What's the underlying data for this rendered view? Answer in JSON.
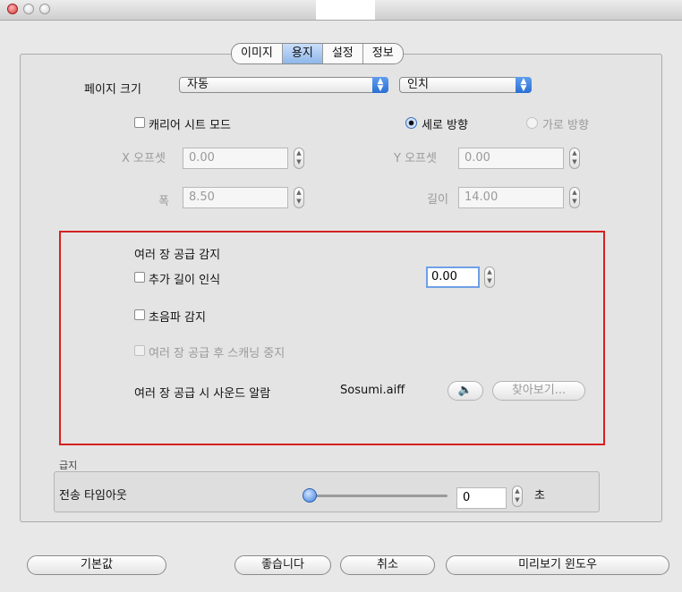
{
  "tabs": [
    "이미지",
    "용지",
    "설정",
    "정보"
  ],
  "selected_tab": "용지",
  "page_size": {
    "label": "페이지 크기",
    "value": "자동",
    "unit": "인치"
  },
  "carrier_sheet": {
    "label": "캐리어 시트 모드",
    "checked": false
  },
  "orientation": {
    "portrait": "세로 방향",
    "landscape": "가로 방향",
    "selected": "portrait"
  },
  "offsets": {
    "x_label": "X 오프셋",
    "x_value": "0.00",
    "y_label": "Y 오프셋",
    "y_value": "0.00",
    "width_label": "폭",
    "width_value": "8.50",
    "length_label": "길이",
    "length_value": "14.00"
  },
  "multifeed": {
    "title": "여러 장 공급 감지",
    "extra_length_label": "추가 길이 인식",
    "extra_length_value": "0.00",
    "ultrasonic_label": "초음파 감지",
    "stop_label": "여러 장 공급 후 스캐닝 중지",
    "sound_label": "여러 장 공급 시 사운드 알람",
    "sound_file": "Sosumi.aiff",
    "speaker_icon": "speaker-icon",
    "browse_label": "찾아보기..."
  },
  "feed": {
    "group_label": "급지",
    "timeout_label": "전송 타임아웃",
    "timeout_value": "0",
    "timeout_unit": "초",
    "slider_level": 0
  },
  "buttons": {
    "default": "기본값",
    "ok": "좋습니다",
    "cancel": "취소",
    "preview": "미리보기 윈도우"
  },
  "colors": {
    "highlight_box": "#d62020",
    "selected_tab": "#8fb7ea"
  }
}
